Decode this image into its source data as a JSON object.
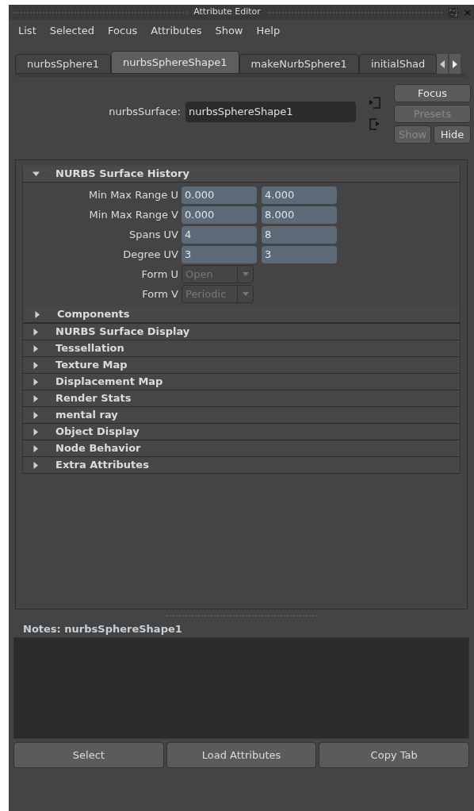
{
  "window": {
    "title": "Attribute Editor"
  },
  "menu": [
    "List",
    "Selected",
    "Focus",
    "Attributes",
    "Show",
    "Help"
  ],
  "tabs": [
    {
      "label": "nurbsSphere1",
      "selected": false
    },
    {
      "label": "nurbsSphereShape1",
      "selected": true
    },
    {
      "label": "makeNurbSphere1",
      "selected": false
    },
    {
      "label": "initialShad",
      "selected": false
    }
  ],
  "node": {
    "label": "nurbsSurface:",
    "value": "nurbsSphereShape1"
  },
  "side_buttons": [
    {
      "label": "Focus",
      "disabled": false
    },
    {
      "label": "Presets",
      "disabled": true
    },
    {
      "label": "Show",
      "disabled": true
    },
    {
      "label": "Hide",
      "disabled": false
    }
  ],
  "sections": [
    {
      "title": "NURBS Surface History",
      "expanded": true,
      "attributes": [
        {
          "kind": "pair",
          "label": "Min Max Range U",
          "values": [
            "0.000",
            "4.000"
          ]
        },
        {
          "kind": "pair",
          "label": "Min Max Range V",
          "values": [
            "0.000",
            "8.000"
          ]
        },
        {
          "kind": "pair",
          "label": "Spans UV",
          "values": [
            "4",
            "8"
          ]
        },
        {
          "kind": "pair",
          "label": "Degree UV",
          "values": [
            "3",
            "3"
          ]
        },
        {
          "kind": "enum",
          "label": "Form U",
          "value": "Open"
        },
        {
          "kind": "enum",
          "label": "Form V",
          "value": "Periodic"
        }
      ],
      "subsections": [
        {
          "title": "Components",
          "expanded": false
        }
      ]
    },
    {
      "title": "NURBS Surface Display",
      "expanded": false
    },
    {
      "title": "Tessellation",
      "expanded": false
    },
    {
      "title": "Texture Map",
      "expanded": false
    },
    {
      "title": "Displacement Map",
      "expanded": false
    },
    {
      "title": "Render Stats",
      "expanded": false
    },
    {
      "title": "mental ray",
      "expanded": false
    },
    {
      "title": "Object Display",
      "expanded": false
    },
    {
      "title": "Node Behavior",
      "expanded": false
    },
    {
      "title": "Extra Attributes",
      "expanded": false
    }
  ],
  "notes": {
    "label": "Notes: nurbsSphereShape1"
  },
  "buttons": [
    "Select",
    "Load Attributes",
    "Copy Tab"
  ]
}
